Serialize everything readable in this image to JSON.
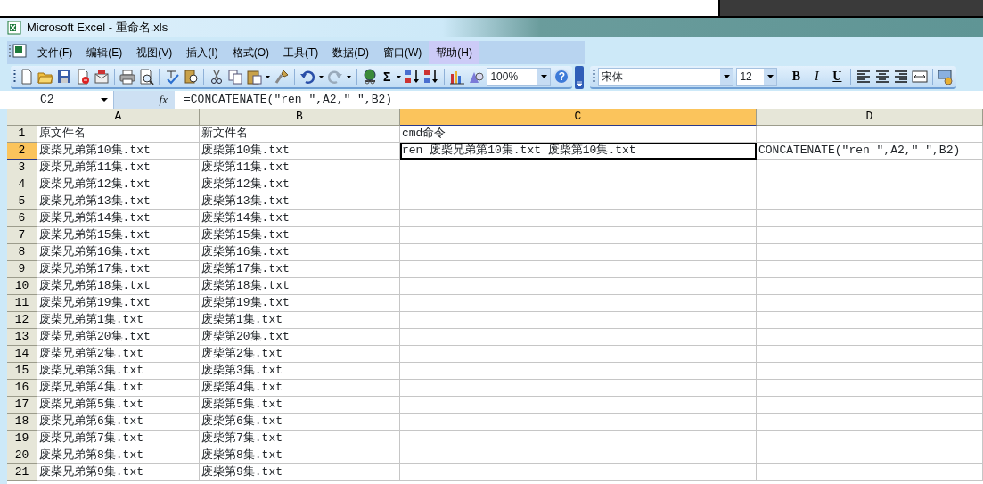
{
  "window": {
    "title": "Microsoft Excel - 重命名.xls"
  },
  "menu": [
    {
      "label": "文件(F)",
      "highlighted": false
    },
    {
      "label": "编辑(E)",
      "highlighted": false
    },
    {
      "label": "视图(V)",
      "highlighted": false
    },
    {
      "label": "插入(I)",
      "highlighted": false
    },
    {
      "label": "格式(O)",
      "highlighted": false
    },
    {
      "label": "工具(T)",
      "highlighted": false
    },
    {
      "label": "数据(D)",
      "highlighted": false
    },
    {
      "label": "窗口(W)",
      "highlighted": false
    },
    {
      "label": "帮助(H)",
      "highlighted": true
    }
  ],
  "toolbar": {
    "sum": "Σ",
    "zoom": "100%",
    "help": "?",
    "font": "宋体",
    "font_size": "12",
    "bold": "B",
    "italic": "I",
    "underline": "U"
  },
  "formula_bar": {
    "cell_ref": "C2",
    "fx": "fx",
    "formula": "=CONCATENATE(\"ren \",A2,\" \",B2)"
  },
  "columns": [
    {
      "label": "A",
      "selected": false
    },
    {
      "label": "B",
      "selected": false
    },
    {
      "label": "C",
      "selected": true
    },
    {
      "label": "D",
      "selected": false
    }
  ],
  "rows": [
    {
      "number": "1",
      "selected": false,
      "cells": [
        "原文件名",
        "新文件名",
        "cmd命令"
      ]
    },
    {
      "number": "2",
      "selected": true,
      "cells": [
        "废柴兄弟第10集.txt",
        "废柴第10集.txt",
        "ren 废柴兄弟第10集.txt 废柴第10集.txt",
        "CONCATENATE(\"ren \",A2,\" \",B2)"
      ]
    },
    {
      "number": "3",
      "selected": false,
      "cells": [
        "废柴兄弟第11集.txt",
        "废柴第11集.txt"
      ]
    },
    {
      "number": "4",
      "selected": false,
      "cells": [
        "废柴兄弟第12集.txt",
        "废柴第12集.txt"
      ]
    },
    {
      "number": "5",
      "selected": false,
      "cells": [
        "废柴兄弟第13集.txt",
        "废柴第13集.txt"
      ]
    },
    {
      "number": "6",
      "selected": false,
      "cells": [
        "废柴兄弟第14集.txt",
        "废柴第14集.txt"
      ]
    },
    {
      "number": "7",
      "selected": false,
      "cells": [
        "废柴兄弟第15集.txt",
        "废柴第15集.txt"
      ]
    },
    {
      "number": "8",
      "selected": false,
      "cells": [
        "废柴兄弟第16集.txt",
        "废柴第16集.txt"
      ]
    },
    {
      "number": "9",
      "selected": false,
      "cells": [
        "废柴兄弟第17集.txt",
        "废柴第17集.txt"
      ]
    },
    {
      "number": "10",
      "selected": false,
      "cells": [
        "废柴兄弟第18集.txt",
        "废柴第18集.txt"
      ]
    },
    {
      "number": "11",
      "selected": false,
      "cells": [
        "废柴兄弟第19集.txt",
        "废柴第19集.txt"
      ]
    },
    {
      "number": "12",
      "selected": false,
      "cells": [
        "废柴兄弟第1集.txt",
        "废柴第1集.txt"
      ]
    },
    {
      "number": "13",
      "selected": false,
      "cells": [
        "废柴兄弟第20集.txt",
        "废柴第20集.txt"
      ]
    },
    {
      "number": "14",
      "selected": false,
      "cells": [
        "废柴兄弟第2集.txt",
        "废柴第2集.txt"
      ]
    },
    {
      "number": "15",
      "selected": false,
      "cells": [
        "废柴兄弟第3集.txt",
        "废柴第3集.txt"
      ]
    },
    {
      "number": "16",
      "selected": false,
      "cells": [
        "废柴兄弟第4集.txt",
        "废柴第4集.txt"
      ]
    },
    {
      "number": "17",
      "selected": false,
      "cells": [
        "废柴兄弟第5集.txt",
        "废柴第5集.txt"
      ]
    },
    {
      "number": "18",
      "selected": false,
      "cells": [
        "废柴兄弟第6集.txt",
        "废柴第6集.txt"
      ]
    },
    {
      "number": "19",
      "selected": false,
      "cells": [
        "废柴兄弟第7集.txt",
        "废柴第7集.txt"
      ]
    },
    {
      "number": "20",
      "selected": false,
      "cells": [
        "废柴兄弟第8集.txt",
        "废柴第8集.txt"
      ]
    },
    {
      "number": "21",
      "selected": false,
      "cells": [
        "废柴兄弟第9集.txt",
        "废柴第9集.txt"
      ]
    }
  ]
}
